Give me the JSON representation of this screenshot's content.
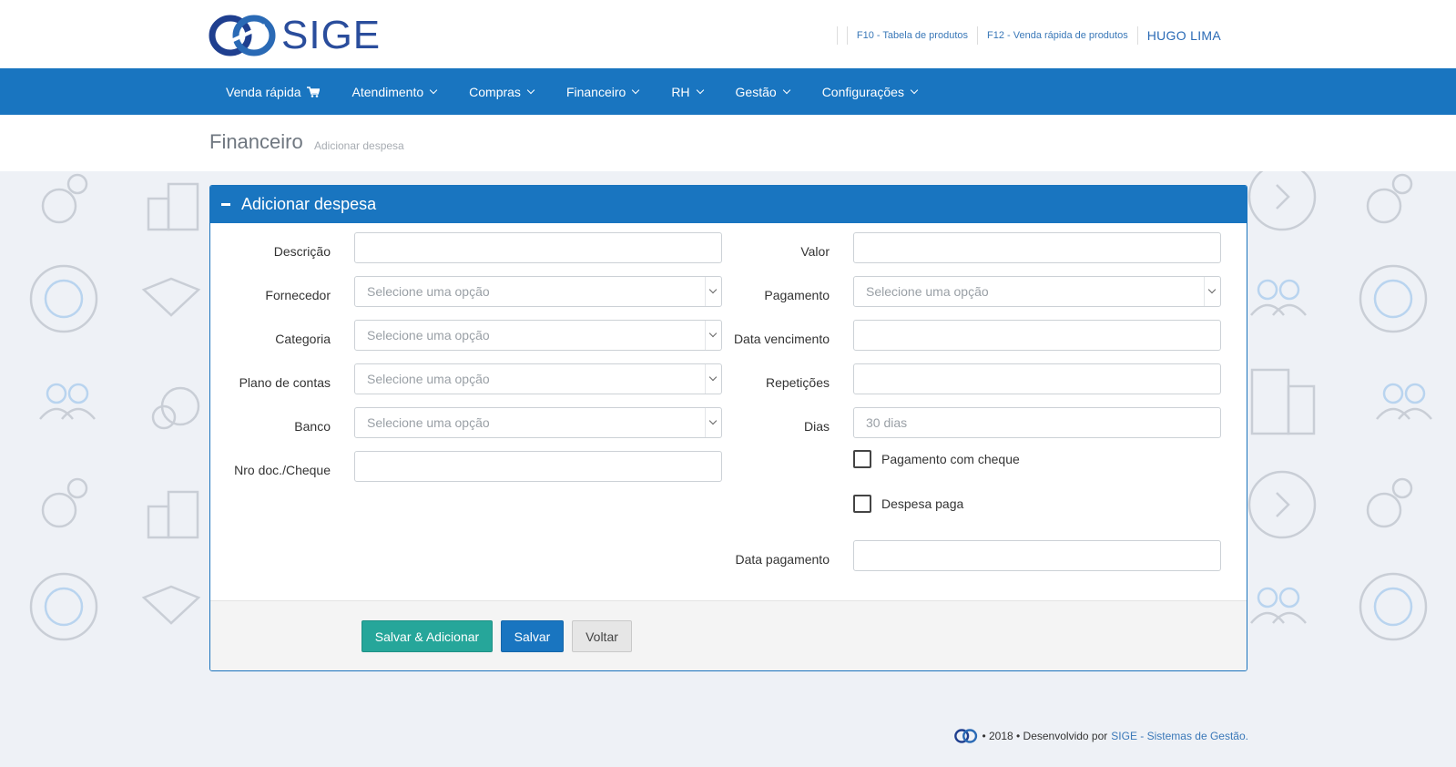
{
  "header": {
    "logo_text": "SIGE",
    "links": [
      "F10 - Tabela de produtos",
      "F12 - Venda rápida de produtos"
    ],
    "user": "HUGO LIMA"
  },
  "nav": {
    "items": [
      {
        "label": "Venda rápida",
        "icon": "cart-icon"
      },
      {
        "label": "Atendimento"
      },
      {
        "label": "Compras"
      },
      {
        "label": "Financeiro"
      },
      {
        "label": "RH"
      },
      {
        "label": "Gestão"
      },
      {
        "label": "Configurações"
      }
    ]
  },
  "page": {
    "title": "Financeiro",
    "subtitle": "Adicionar despesa"
  },
  "panel": {
    "title": "Adicionar despesa",
    "left_fields": [
      {
        "label": "Descrição",
        "value": "",
        "type": "text"
      },
      {
        "label": "Fornecedor",
        "value": "Selecione uma opção",
        "type": "select"
      },
      {
        "label": "Categoria",
        "value": "Selecione uma opção",
        "type": "select"
      },
      {
        "label": "Plano de contas",
        "value": "Selecione uma opção",
        "type": "select"
      },
      {
        "label": "Banco",
        "value": "Selecione uma opção",
        "type": "select"
      },
      {
        "label": "Nro doc./Cheque",
        "value": "",
        "type": "text"
      }
    ],
    "right_fields": [
      {
        "label": "Valor",
        "value": "",
        "type": "text"
      },
      {
        "label": "Pagamento",
        "value": "Selecione uma opção",
        "type": "select"
      },
      {
        "label": "Data vencimento",
        "value": "",
        "type": "text"
      },
      {
        "label": "Repetições",
        "value": "",
        "type": "text"
      },
      {
        "label": "Dias",
        "placeholder": "30 dias",
        "type": "text"
      }
    ],
    "checkboxes": [
      {
        "label": "Pagamento com cheque",
        "checked": false
      },
      {
        "label": "Despesa paga",
        "checked": false
      }
    ],
    "payment_date": {
      "label": "Data pagamento",
      "value": ""
    },
    "buttons": {
      "save_add": "Salvar & Adicionar",
      "save": "Salvar",
      "back": "Voltar"
    }
  },
  "footer": {
    "text": "• 2018 • Desenvolvido por",
    "brand": "SIGE - Sistemas de Gestão."
  },
  "colors": {
    "primary": "#1975c0",
    "success": "#26a69a",
    "background": "#eef1f6"
  }
}
